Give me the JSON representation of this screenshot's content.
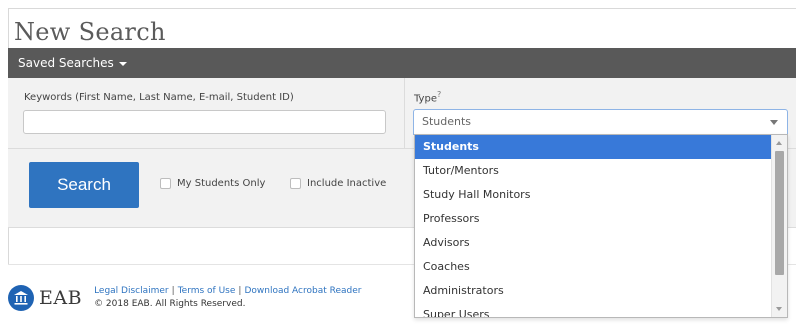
{
  "header": {
    "title": "New Search",
    "saved_searches_label": "Saved Searches"
  },
  "form": {
    "keywords_label": "Keywords (First Name, Last Name, E-mail, Student ID)",
    "keywords_value": "",
    "type_label": "Type",
    "type_help": "?",
    "type_selected": "Students",
    "type_options": [
      "Students",
      "Tutor/Mentors",
      "Study Hall Monitors",
      "Professors",
      "Advisors",
      "Coaches",
      "Administrators",
      "Super Users"
    ],
    "search_button": "Search",
    "checkbox_my_students": "My Students Only",
    "checkbox_include_inactive": "Include Inactive"
  },
  "footer": {
    "logo_text": "EAB",
    "links": [
      "Legal Disclaimer",
      "Terms of Use",
      "Download Acrobat Reader"
    ],
    "separator": "|",
    "copyright": "© 2018 EAB. All Rights Reserved."
  },
  "colors": {
    "toolbar": "#595959",
    "primary_blue": "#2f74c0",
    "selected_option": "#3879d9"
  }
}
